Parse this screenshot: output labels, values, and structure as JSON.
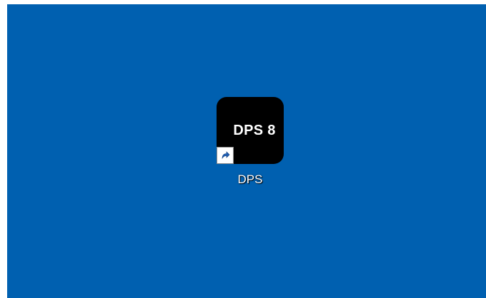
{
  "desktop": {
    "background_color": "#0060B0",
    "shortcuts": [
      {
        "tile_text": "DPS 8",
        "label": "DPS",
        "tile_color": "#000000",
        "overlay_icon": "shortcut-arrow-icon"
      }
    ]
  }
}
